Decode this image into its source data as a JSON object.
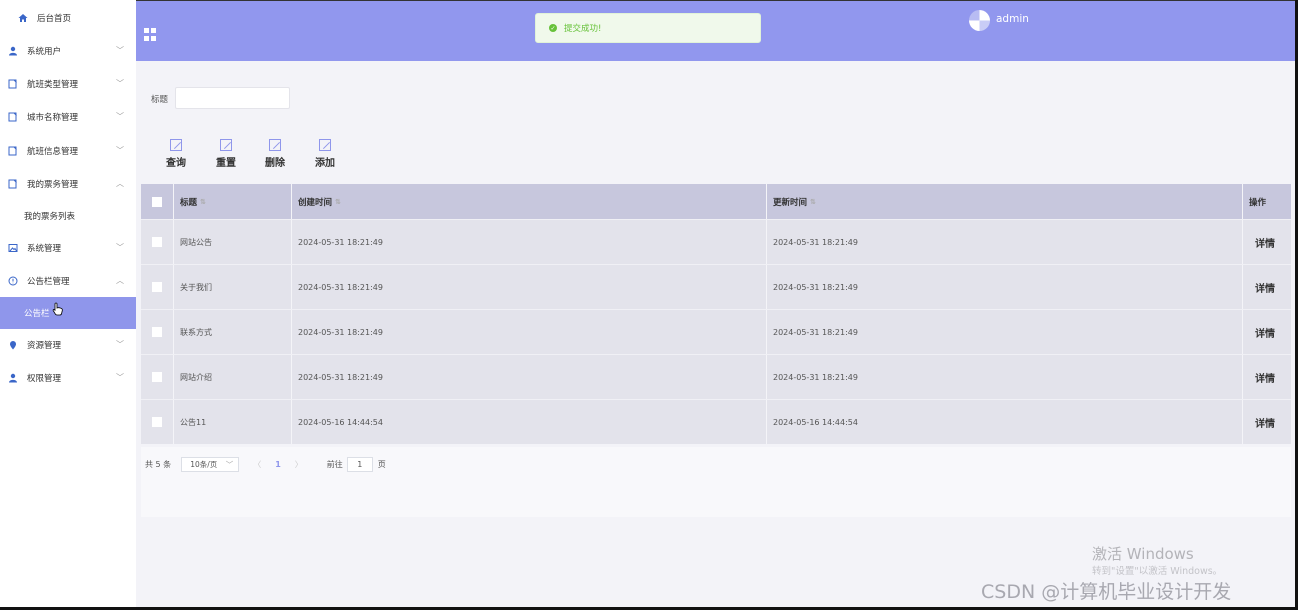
{
  "sidebar": {
    "home": "后台首页",
    "items": [
      {
        "label": "系统用户",
        "icon": "user-icon",
        "expanded": false
      },
      {
        "label": "航班类型管理",
        "icon": "doc-icon",
        "expanded": false
      },
      {
        "label": "城市名称管理",
        "icon": "doc-icon",
        "expanded": false
      },
      {
        "label": "航班信息管理",
        "icon": "doc-icon",
        "expanded": false
      },
      {
        "label": "我的票务管理",
        "icon": "doc-icon",
        "expanded": true
      },
      {
        "label": "系统管理",
        "icon": "image-icon",
        "expanded": false
      },
      {
        "label": "公告栏管理",
        "icon": "info-icon",
        "expanded": true
      },
      {
        "label": "资源管理",
        "icon": "location-icon",
        "expanded": false
      },
      {
        "label": "权限管理",
        "icon": "user-icon",
        "expanded": false
      }
    ],
    "sub_ticket_list": "我的票务列表",
    "sub_notice": "公告栏"
  },
  "header": {
    "toast": "提交成功!",
    "username": "admin"
  },
  "search": {
    "label": "标题",
    "value": ""
  },
  "toolbar": {
    "query": "查询",
    "reset": "重置",
    "delete": "删除",
    "add": "添加"
  },
  "table": {
    "columns": [
      "标题",
      "创建时间",
      "更新时间",
      "操作"
    ],
    "rows": [
      {
        "title": "网站公告",
        "created": "2024-05-31 18:21:49",
        "updated": "2024-05-31 18:21:49",
        "action": "详情"
      },
      {
        "title": "关于我们",
        "created": "2024-05-31 18:21:49",
        "updated": "2024-05-31 18:21:49",
        "action": "详情"
      },
      {
        "title": "联系方式",
        "created": "2024-05-31 18:21:49",
        "updated": "2024-05-31 18:21:49",
        "action": "详情"
      },
      {
        "title": "网站介绍",
        "created": "2024-05-31 18:21:49",
        "updated": "2024-05-31 18:21:49",
        "action": "详情"
      },
      {
        "title": "公告11",
        "created": "2024-05-16 14:44:54",
        "updated": "2024-05-16 14:44:54",
        "action": "详情"
      }
    ]
  },
  "pagination": {
    "total": "共 5 条",
    "page_size": "10条/页",
    "current": "1",
    "goto_label": "前往",
    "goto_value": "1",
    "page_word": "页"
  },
  "watermark": {
    "win_title": "激活 Windows",
    "win_sub": "转到\"设置\"以激活 Windows。",
    "csdn": "CSDN @计算机毕业设计开发"
  },
  "colors": {
    "accent": "#9197ee",
    "success": "#67c23a"
  }
}
